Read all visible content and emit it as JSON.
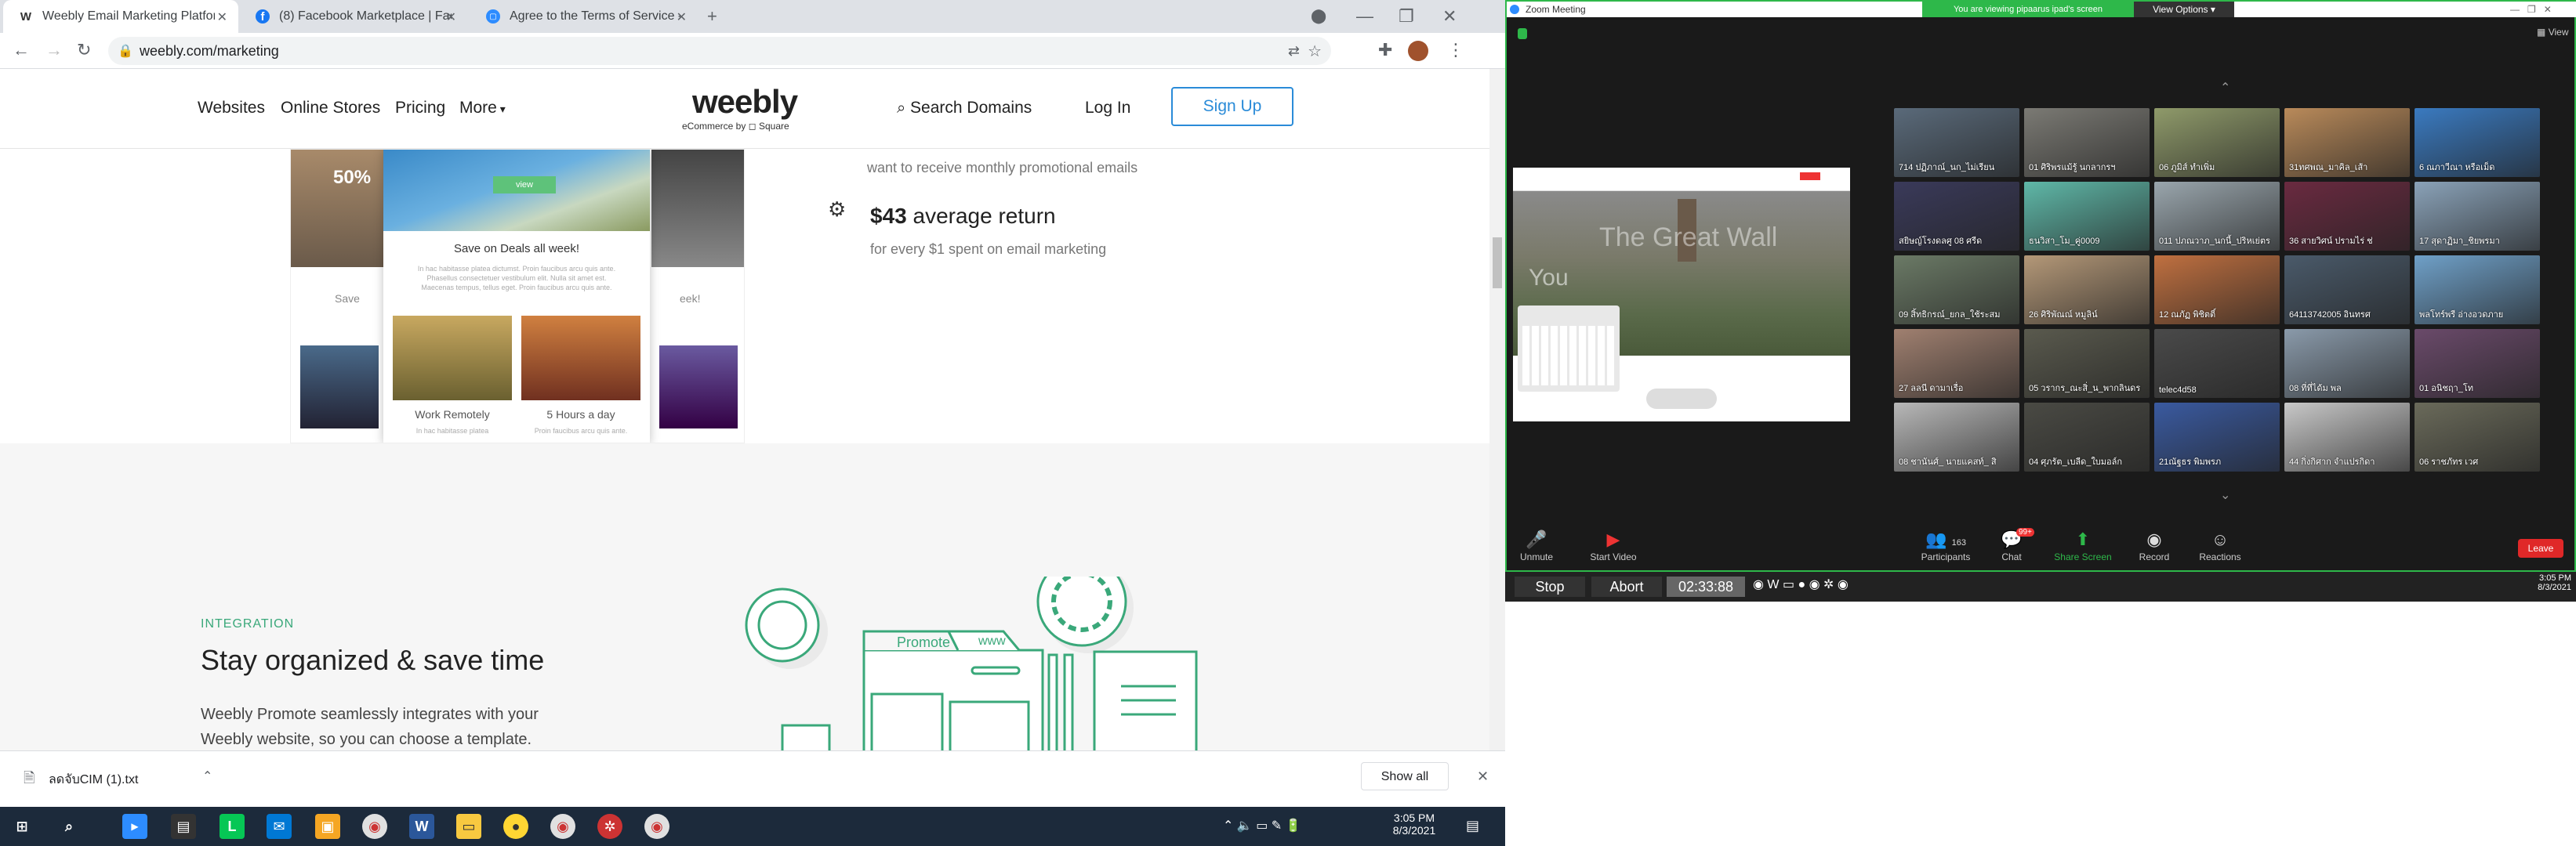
{
  "browser": {
    "tabs": [
      {
        "favicon": "W",
        "title": "Weebly Email Marketing Platform",
        "active": true
      },
      {
        "favicon": "f",
        "title": "(8) Facebook Marketplace | Faceb",
        "active": false
      },
      {
        "favicon": "▢",
        "title": "Agree to the Terms of Service - 2",
        "active": false
      }
    ],
    "new_tab": "+",
    "url": "weebly.com/marketing"
  },
  "site": {
    "nav": [
      "Websites",
      "Online Stores",
      "Pricing",
      "More"
    ],
    "logo": "weebly",
    "logo_sub": "eCommerce by ◻ Square",
    "search": "Search Domains",
    "login": "Log In",
    "signup": "Sign Up",
    "promo_text": "want to receive monthly promotional emails",
    "stat_value": "$43",
    "stat_label": "average return",
    "stat_sub": "for every $1 spent on email marketing",
    "mock": {
      "percent": "50%",
      "view": "view",
      "title": "Save on Deals all week!",
      "body": "In hac habitasse platea dictumst. Proin faucibus arcu quis ante. Phasellus consectetuer vestibulum elit. Nulla sit amet est. Maecenas tempus, tellus eget. Proin faucibus arcu quis ante.",
      "left_save": "Save",
      "right_week": "eek!",
      "img1_caption": "Work Remotely",
      "img2_caption": "5 Hours a day",
      "img1_text": "In hac habitasse platea",
      "img2_text": "Proin faucibus arcu quis ante."
    },
    "integration_label": "INTEGRATION",
    "integration_title": "Stay organized & save time",
    "integration_body": "Weebly Promote seamlessly integrates with your Weebly website, so you can choose a template.",
    "illus": {
      "promote": "Promote",
      "www": "www"
    }
  },
  "downloads": {
    "file": "ลดจับCIM (1).txt",
    "show_all": "Show all"
  },
  "taskbar": {
    "time": "3:05 PM",
    "date": "8/3/2021"
  },
  "zoom": {
    "window_title": "Zoom Meeting",
    "banner": "You are viewing pipaarus ipad's screen",
    "view_options": "View Options ▾",
    "view": "View",
    "shared_title": "The Great Wall",
    "shared_sub": "You",
    "participants": [
      {
        "name": "714 ปฏิภาณ์_นก_ไม่เรียน",
        "color": "#5a6a7a"
      },
      {
        "name": "01 ศิริพรแม้รู้ นกลากรฯ",
        "color": "#7b7a74"
      },
      {
        "name": "06 ภูมิส์ ทำเพิ่ม",
        "color": "#8f9a6a"
      },
      {
        "name": "31ทศพณ_มาคิล_เส้า",
        "color": "#b98a5a"
      },
      {
        "name": "6 ณภาวีณา หรือเม็ด",
        "color": "#3a7ac0"
      },
      {
        "name": "สยิษญ์โรงดลศู 08 ศรีด",
        "color": "#3a3a5a"
      },
      {
        "name": "ธนวิสา_โม_คู่0009",
        "color": "#5fb8a8"
      },
      {
        "name": "011 ปภณวาภ_นกนี้_ปริหเย่ตร",
        "color": "#9aa6ad"
      },
      {
        "name": "36 สายวิศน์ ปรามไร่ ช่",
        "color": "#6a2a40"
      },
      {
        "name": "17 สุดาฏิมา_ชิยพรมา",
        "color": "#8aa2b8"
      },
      {
        "name": "09 สิ้ทธิกรณ์_ยกล_ใช้ระสม",
        "color": "#6b7a66"
      },
      {
        "name": "26 ศิริพัณณ์ หมูลิน์",
        "color": "#b49878"
      },
      {
        "name": "12 ณภัฏ พิชิตติ์",
        "color": "#c07040"
      },
      {
        "name": "64113742005 อินทรศ",
        "color": "#4a5a6a"
      },
      {
        "name": "พลโทร์พรี อ่างอวดภาย",
        "color": "#6fa0c8"
      },
      {
        "name": "27 ลลนี ดามาเรื่อ",
        "color": "#a08070"
      },
      {
        "name": "05 วรากร_ณะสิ่_น_พากลินดร",
        "color": "#5a5a4e"
      },
      {
        "name": "telec4d58",
        "color": "#4a4a4a"
      },
      {
        "name": "08 ที่ที่ได้ม พล",
        "color": "#8a9aaa"
      },
      {
        "name": "01 อนิชฤา_โท",
        "color": "#6a4a6a"
      },
      {
        "name": "08 ชานันศ์_ นายแคสท์_ สิ",
        "color": "#b8b8b8"
      },
      {
        "name": "04 ศุภรัต_เบลีด_ใบมอล์ก",
        "color": "#4a4a44"
      },
      {
        "name": "21ณัฐธร พิมพรภ",
        "color": "#3a5aa0"
      },
      {
        "name": "44 กิ่งกิศาก จำแปรกิดา",
        "color": "#c8c8c8"
      },
      {
        "name": "06 ราชภัทร เวศ",
        "color": "#6a6a5a"
      }
    ],
    "controls": {
      "unmute": "Unmute",
      "start_video": "Start Video",
      "participants": "Participants",
      "participants_count": "163",
      "chat": "Chat",
      "chat_badge": "99+",
      "share_screen": "Share Screen",
      "record": "Record",
      "reactions": "Reactions",
      "leave": "Leave"
    },
    "recorder": {
      "stop": "Stop",
      "abort": "Abort",
      "timer": "02:33:88"
    },
    "clock_time": "3:05 PM",
    "clock_date": "8/3/2021"
  },
  "colors": {
    "accent_green": "#2eb84a",
    "weebly_blue": "#2a8bd8",
    "integration_green": "#3aa87a"
  }
}
